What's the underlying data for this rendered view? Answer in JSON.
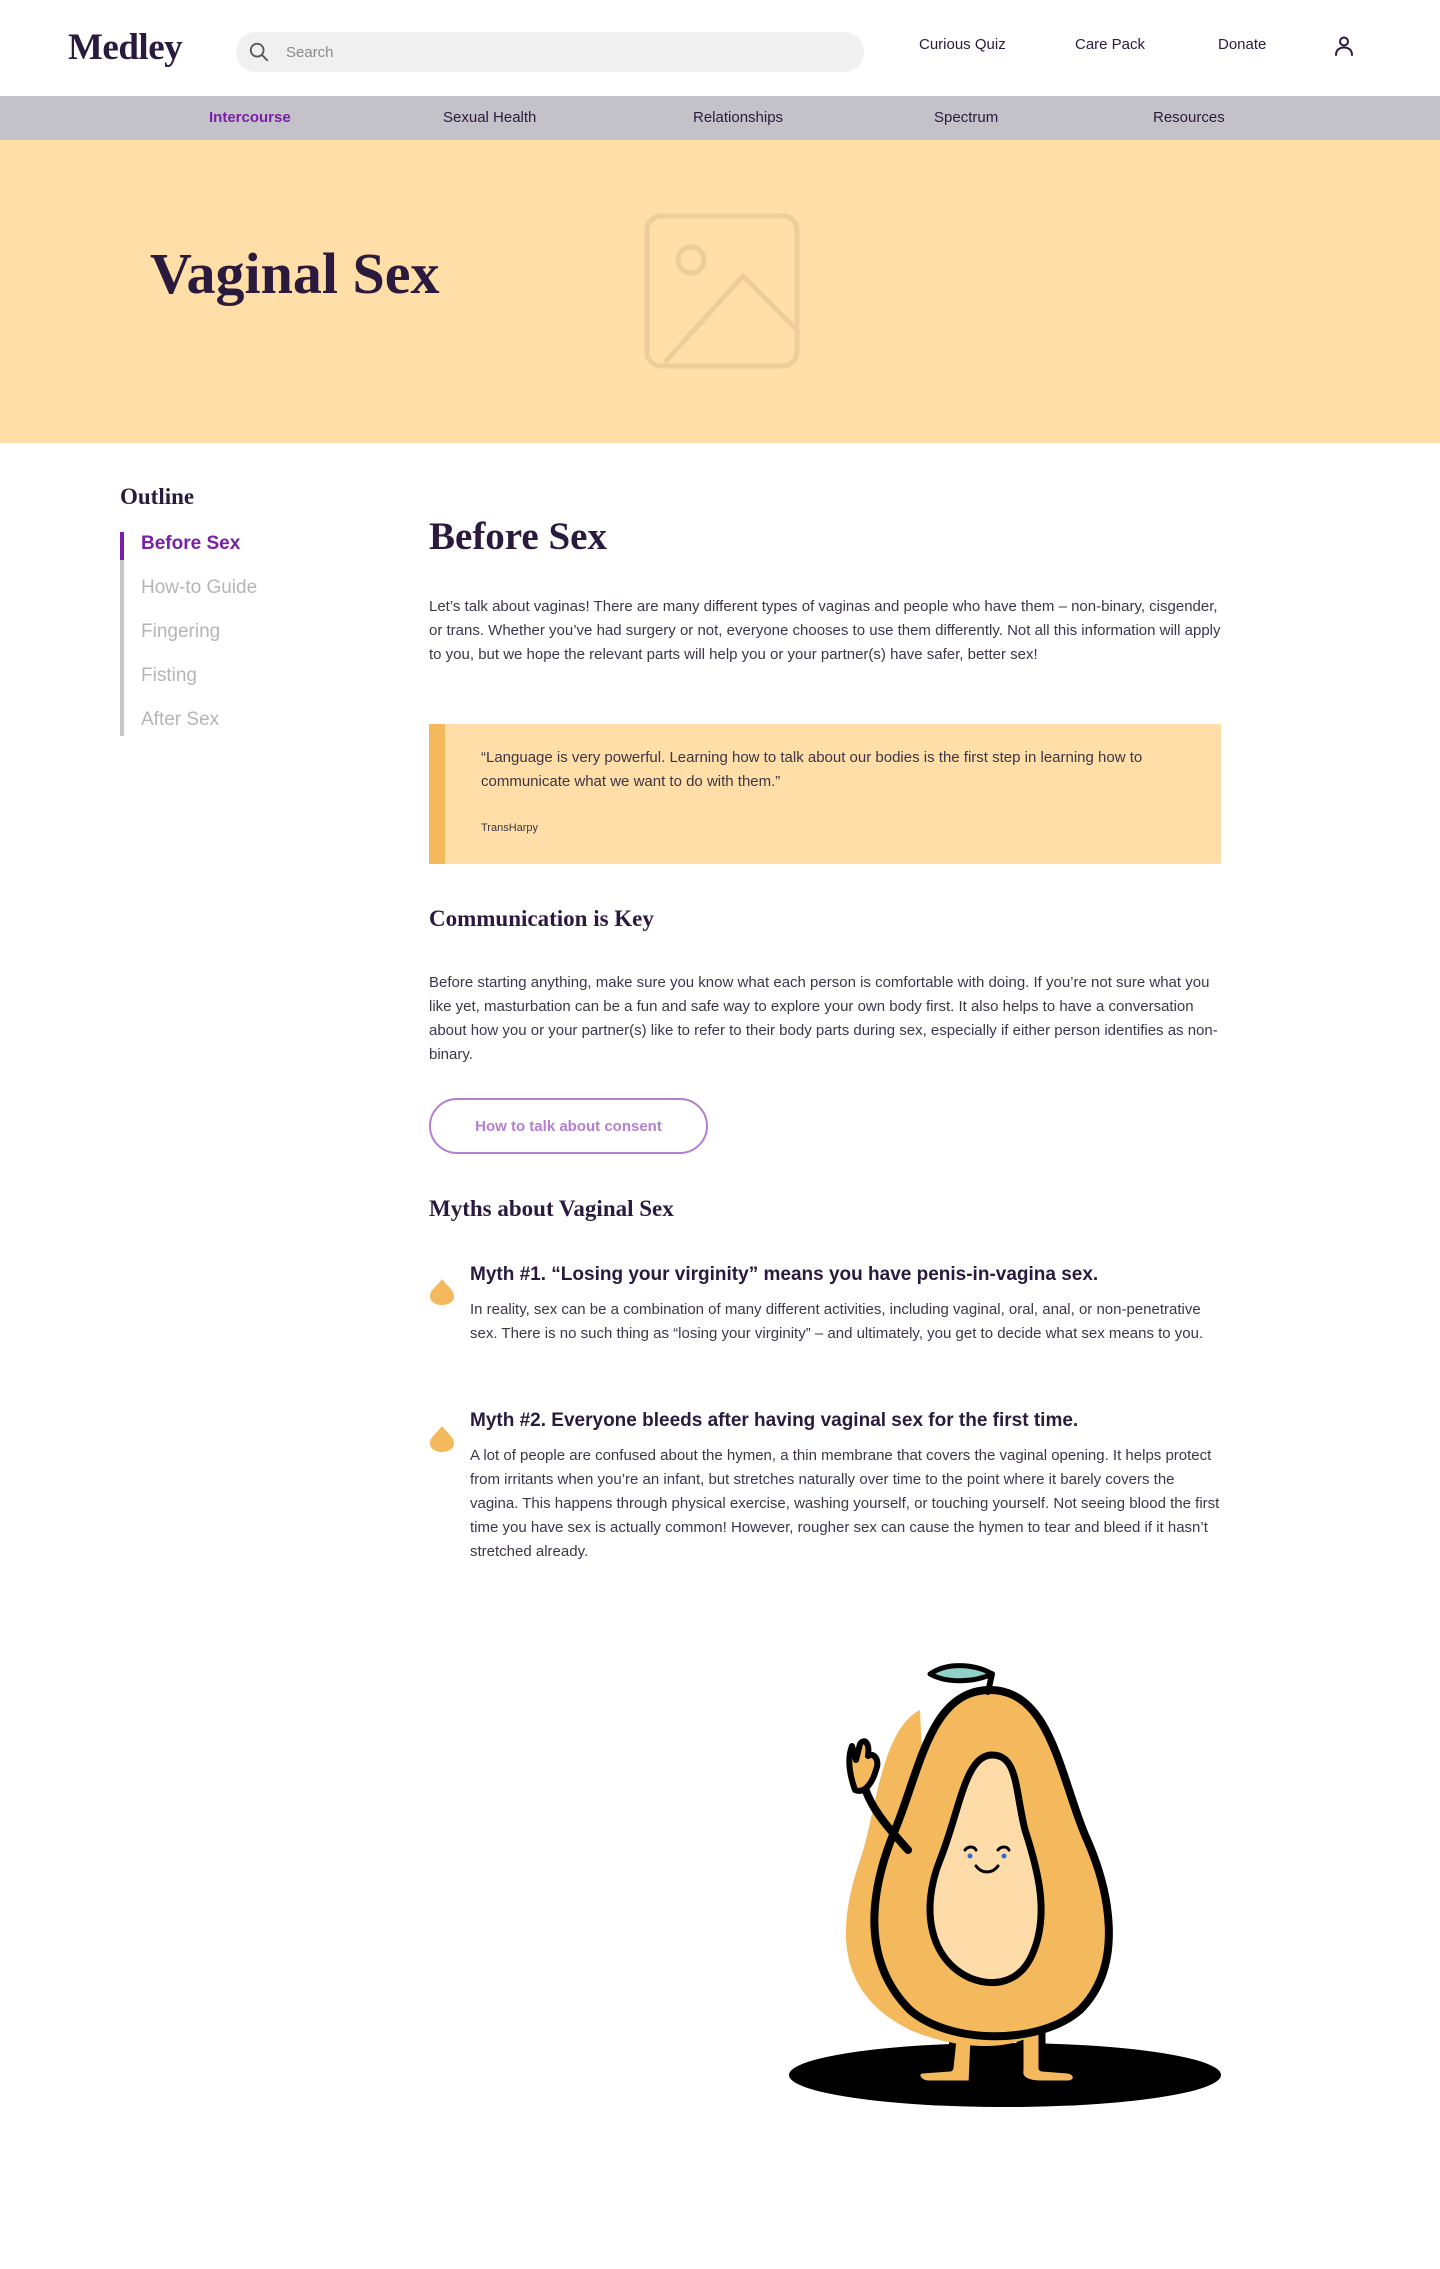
{
  "header": {
    "logo": "Medley",
    "search_placeholder": "Search",
    "links": [
      "Curious Quiz",
      "Care Pack",
      "Donate"
    ]
  },
  "catnav": {
    "items": [
      "Intercourse",
      "Sexual Health",
      "Relationships",
      "Spectrum",
      "Resources"
    ],
    "active": "Intercourse"
  },
  "hero": {
    "title": "Vaginal Sex"
  },
  "outline": {
    "title": "Outline",
    "items": [
      "Before Sex",
      "How-to Guide",
      "Fingering",
      "Fisting",
      "After Sex"
    ],
    "active": "Before Sex"
  },
  "content": {
    "heading": "Before Sex",
    "intro": "Let’s talk about vaginas! There are many different types of vaginas and people who have them – non-binary, cisgender, or trans. Whether you’ve had surgery or not, everyone chooses to use them differently. Not all this information will apply to you, but we hope the relevant parts will help you or your partner(s) have safer, better sex!",
    "quote": {
      "text": "“Language is very powerful. Learning how to talk about our bodies is the first step in learning how to communicate what we want to do with them.”",
      "author": "TransHarpy"
    },
    "communication": {
      "heading": "Communication is Key",
      "body": "Before starting anything, make sure you know what each person is comfortable with doing. If you’re not sure what you like yet, masturbation can be a fun and safe way to explore your own body first. It also helps to have a conversation about how you or your partner(s) like to refer to their body parts during sex, especially if either person identifies as non-binary.",
      "button": "How to talk about consent"
    },
    "myths": {
      "heading": "Myths about Vaginal Sex",
      "items": [
        {
          "title": "Myth #1. “Losing your virginity” means you have penis-in-vagina sex.",
          "body": "In reality, sex can be a combination of many different activities, including vaginal, oral, anal, or non-penetrative sex. There is no such thing as “losing your virginity” – and ultimately, you get to decide what sex means to you."
        },
        {
          "title": "Myth #2. Everyone bleeds after having vaginal sex for the first time.",
          "body": "A lot of people are confused about the hymen, a thin membrane that covers the vaginal opening. It helps protect from irritants when you’re an infant, but stretches naturally over time to the point where it barely covers the vagina. This happens through physical exercise, washing yourself, or touching yourself. Not seeing blood the first time you have sex is actually common! However, rougher sex can cause the hymen to tear and bleed if it hasn’t stretched already."
        }
      ]
    }
  },
  "colors": {
    "accent": "#7a1fa8",
    "hero_bg": "#ffdea8",
    "quote_bar": "#f4b95c",
    "catnav_bg": "#c3c2c8",
    "button_outline": "#b57ed0"
  },
  "icons": {
    "search": "search-icon",
    "user": "user-icon",
    "hero_image": "image-placeholder-icon",
    "myth_bullet": "droplet-icon"
  }
}
